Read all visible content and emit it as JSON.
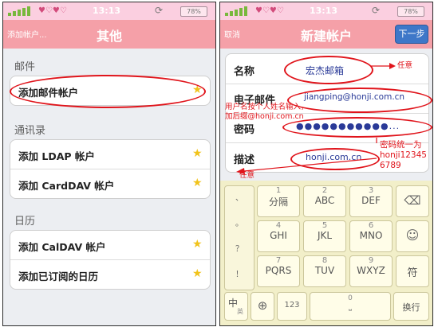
{
  "status": {
    "time": "13:13",
    "battery": "78%"
  },
  "left": {
    "nav": {
      "back": "添加帐户...",
      "title": "其他"
    },
    "sections": [
      {
        "header": "邮件",
        "rows": [
          "添加邮件帐户"
        ]
      },
      {
        "header": "通讯录",
        "rows": [
          "添加 LDAP 帐户",
          "添加 CardDAV 帐户"
        ]
      },
      {
        "header": "日历",
        "rows": [
          "添加 CalDAV 帐户",
          "添加已订阅的日历"
        ]
      }
    ]
  },
  "right": {
    "nav": {
      "cancel": "取消",
      "title": "新建帐户",
      "next": "下一步"
    },
    "form": {
      "name": {
        "label": "名称",
        "value": "宏杰邮箱"
      },
      "email": {
        "label": "电子邮件",
        "value": "jiangping@honji.com.cn"
      },
      "password": {
        "label": "密码",
        "value": "●●●●●●●●●●●..."
      },
      "desc": {
        "label": "描述",
        "value": "honji.com.cn"
      }
    },
    "annotations": {
      "name_note": "任意",
      "email_note_1": "用户名按个人姓名输入，",
      "email_note_2": "加后缀@honji.com.cn",
      "pwd_note_1": "密码统一为",
      "pwd_note_2": "honji12345",
      "pwd_note_3": "6789",
      "desc_note": "任意"
    },
    "keyboard": {
      "punct": [
        "、",
        "。",
        "？",
        "！"
      ],
      "keys": [
        {
          "main": "分隔",
          "sub": "1"
        },
        {
          "main": "ABC",
          "sub": "2"
        },
        {
          "main": "DEF",
          "sub": "3"
        },
        {
          "main": "GHI",
          "sub": "4"
        },
        {
          "main": "JKL",
          "sub": "5"
        },
        {
          "main": "MNO",
          "sub": "6"
        },
        {
          "main": "PQRS",
          "sub": "7"
        },
        {
          "main": "TUV",
          "sub": "8"
        },
        {
          "main": "WXYZ",
          "sub": "9"
        }
      ],
      "fu": "符",
      "lang_main": "中",
      "lang_sub": "英",
      "num_key": "123",
      "space_sub": "0",
      "enter": "换行"
    }
  },
  "colors": {
    "nav": "#f5a0a8",
    "status": "#fbcfe0",
    "annotation": "#e0141b",
    "next_button": "#3e77c8"
  }
}
